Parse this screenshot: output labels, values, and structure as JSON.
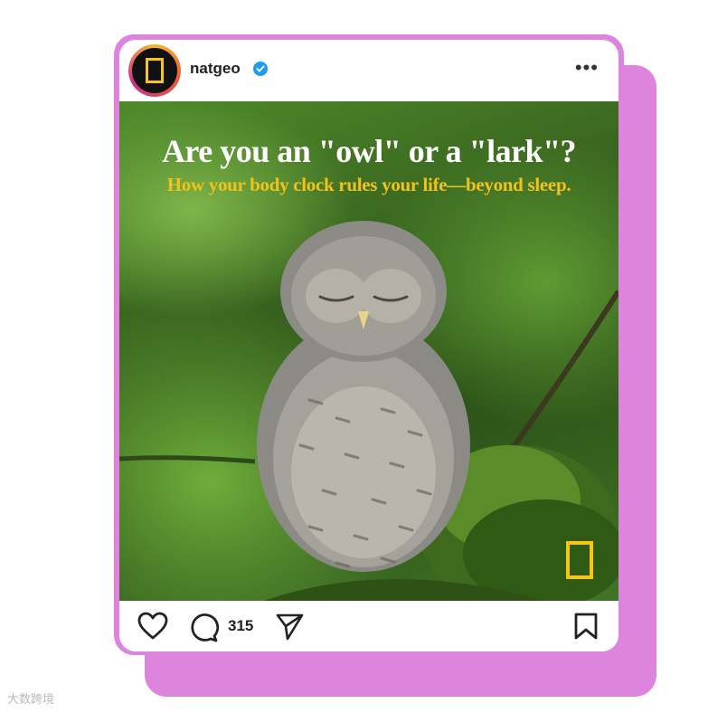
{
  "post": {
    "username": "natgeo",
    "verified": true,
    "more_icon": "more-horizontal-icon",
    "more_label": "•••",
    "headline": "Are you an \"owl\" or a \"lark\"?",
    "subheadline": "How your body clock rules your life—beyond sleep.",
    "comment_count": "315"
  },
  "icons": {
    "like": "heart-icon",
    "comment": "comment-icon",
    "share": "send-icon",
    "save": "bookmark-icon"
  },
  "colors": {
    "frame": "#dd84df",
    "verified_badge": "#1d9bf0",
    "natgeo_yellow": "#f5c518",
    "subheadline": "#f2c21a"
  },
  "watermark": "大数跨境"
}
